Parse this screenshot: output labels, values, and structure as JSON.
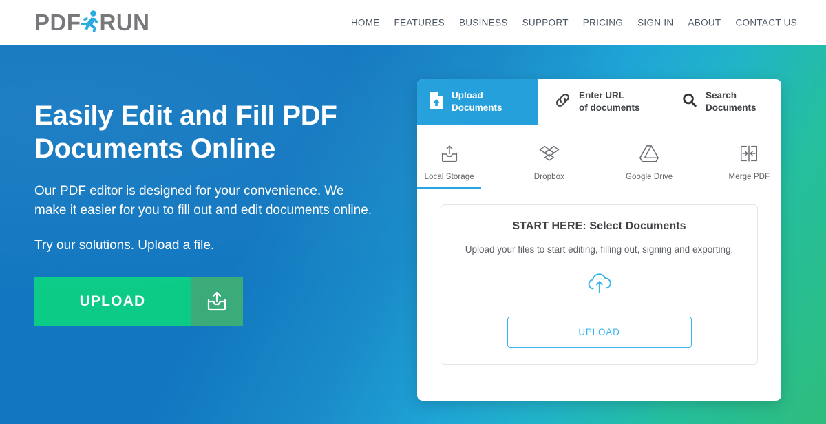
{
  "brand": {
    "name_part1": "PDF",
    "name_part2": "RUN",
    "runner_icon": "running-person-icon",
    "text_color": "#77787b",
    "accent_color": "#29abe2"
  },
  "nav": {
    "items": [
      {
        "label": "HOME"
      },
      {
        "label": "FEATURES"
      },
      {
        "label": "BUSINESS"
      },
      {
        "label": "SUPPORT"
      },
      {
        "label": "PRICING"
      },
      {
        "label": "SIGN IN"
      },
      {
        "label": "ABOUT"
      },
      {
        "label": "CONTACT US"
      }
    ]
  },
  "hero": {
    "title": "Easily Edit and Fill PDF Documents Online",
    "paragraph": "Our PDF editor is designed for your convenience. We make it easier for you to fill out and edit documents online.",
    "subline": "Try our solutions. Upload a file.",
    "upload_button": {
      "label": "UPLOAD",
      "icon": "upload-tray-icon",
      "color": "#0ccb87",
      "icon_panel_color": "#3bab79"
    },
    "background_gradient": {
      "from": "#1277c0",
      "mid": "#21b3c9",
      "to": "#2ebd7c"
    }
  },
  "card": {
    "tabs": [
      {
        "label_line1": "Upload",
        "label_line2": "Documents",
        "icon": "document-upload-icon",
        "active": true
      },
      {
        "label_line1": "Enter URL",
        "label_line2": "of documents",
        "icon": "link-icon",
        "active": false
      },
      {
        "label_line1": "Search",
        "label_line2": "Documents",
        "icon": "search-icon",
        "active": false
      }
    ],
    "active_tab_color": "#239fdb",
    "sources": [
      {
        "label": "Local Storage",
        "icon": "tray-upload-icon",
        "active": true
      },
      {
        "label": "Dropbox",
        "icon": "dropbox-icon",
        "active": false
      },
      {
        "label": "Google Drive",
        "icon": "google-drive-icon",
        "active": false
      },
      {
        "label": "Merge PDF",
        "icon": "merge-pdf-icon",
        "active": false
      }
    ],
    "active_source_underline_color": "#27a6e5",
    "dropzone": {
      "title": "START HERE: Select Documents",
      "subtitle": "Upload your files to start editing, filling out, signing and exporting.",
      "cloud_icon": "cloud-upload-icon",
      "upload_button_label": "UPLOAD",
      "upload_button_color": "#36b5ef"
    }
  }
}
